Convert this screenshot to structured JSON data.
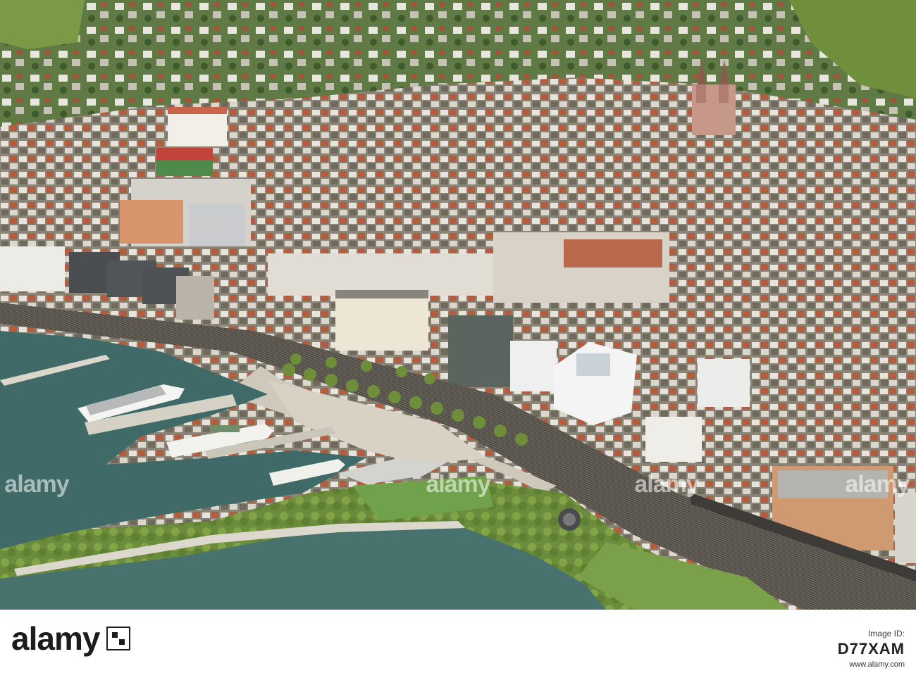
{
  "photo": {
    "subject": "Aerial view of a lakeside town with harbor, boats, promenade and old town"
  },
  "watermark": {
    "overlay_text": "alamy",
    "brand": "alamy",
    "image_id_label": "Image ID:",
    "image_id": "D77XAM",
    "site": "www.alamy.com"
  },
  "colors": {
    "water": "#3f6a68",
    "footer_bg": "#ffffff",
    "logo_text": "#1c1c1c"
  }
}
